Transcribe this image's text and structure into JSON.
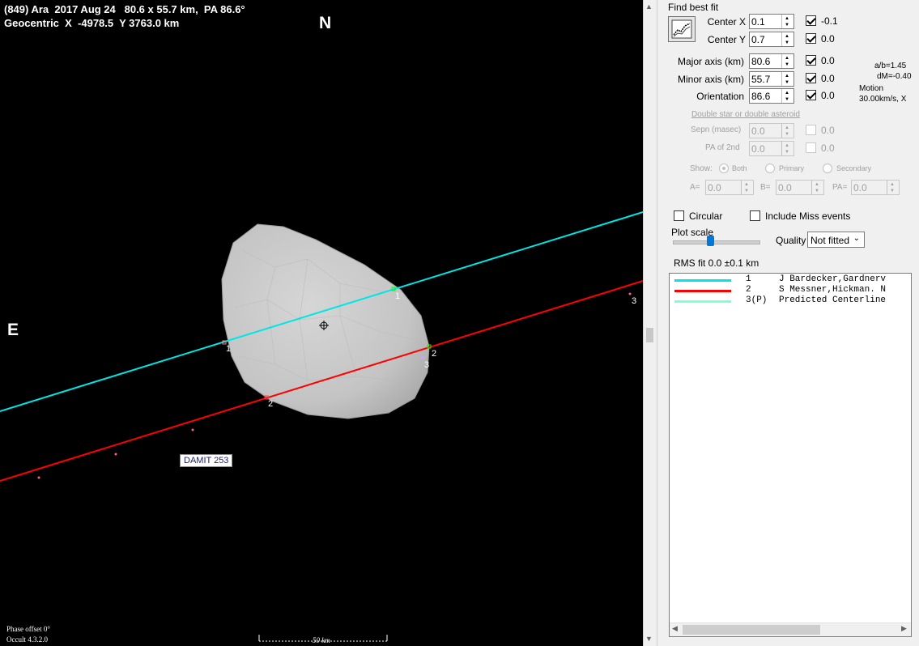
{
  "plot": {
    "title_line1": "(849) Ara  2017 Aug 24   80.6 x 55.7 km,  PA 86.6°",
    "title_line2": "Geocentric  X  -4978.5  Y 3763.0 km",
    "north_label": "N",
    "east_label": "E",
    "shape_label": "DAMIT 253",
    "phase_offset": "Phase offset 0°",
    "version": "Occult 4.3.2.0",
    "scale_label": "50 km",
    "chord_labels": [
      "1",
      "1",
      "2",
      "2",
      "3",
      "3"
    ],
    "colors": {
      "chord1": "#00e5e5",
      "chord2": "#ff0000",
      "shape": "#c8c8c8"
    }
  },
  "panel": {
    "find_best_fit": "Find best fit",
    "center_x": {
      "label": "Center X",
      "value": "0.1",
      "checked": true,
      "fit": "-0.1"
    },
    "center_y": {
      "label": "Center Y",
      "value": "0.7",
      "checked": true,
      "fit": "0.0"
    },
    "major_axis": {
      "label": "Major axis (km)",
      "value": "80.6",
      "checked": true,
      "fit": "0.0"
    },
    "minor_axis": {
      "label": "Minor axis (km)",
      "value": "55.7",
      "checked": true,
      "fit": "0.0"
    },
    "orientation": {
      "label": "Orientation",
      "value": "86.6",
      "checked": true,
      "fit": "0.0"
    },
    "ab_ratio": "a/b=1.45",
    "dm": "dM=-0.40",
    "motion_label": "Motion",
    "motion_value": "30.00km/s, X",
    "double_star": "Double star  or  double asteroid",
    "sepn": {
      "label": "Sepn (masec)",
      "value": "0.0",
      "fit": "0.0"
    },
    "pa2nd": {
      "label": "PA of 2nd",
      "value": "0.0",
      "fit": "0.0"
    },
    "show_label": "Show:",
    "show_options": [
      "Both",
      "Primary",
      "Secondary"
    ],
    "a_label": "A=",
    "a_value": "0.0",
    "b_label": "B=",
    "b_value": "0.0",
    "pa_label": "PA=",
    "pa_value": "0.0",
    "circular": "Circular",
    "include_miss": "Include Miss events",
    "plot_scale": "Plot scale",
    "plot_scale_level": 0.42,
    "quality_label": "Quality",
    "quality_value": "Not fitted",
    "rms": "RMS fit 0.0 ±0.1 km",
    "legend": [
      {
        "id": "1",
        "text": "J Bardecker,Gardnerv",
        "color": "#00e5e5"
      },
      {
        "id": "2",
        "text": "S Messner,Hickman. N",
        "color": "#ff0000"
      },
      {
        "id": "3(P)",
        "text": "Predicted Centerline",
        "color": "#7fffd4"
      }
    ]
  }
}
